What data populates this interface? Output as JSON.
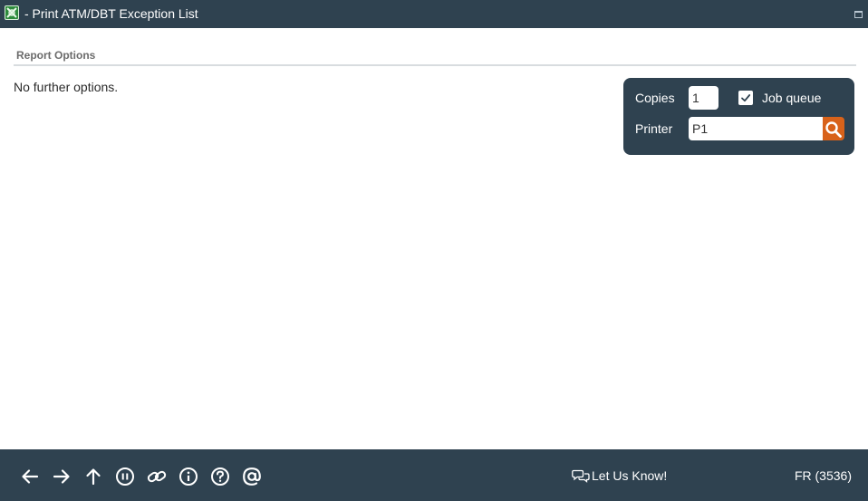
{
  "window": {
    "title": "- Print ATM/DBT Exception List",
    "app_icon": "app-logo-icon",
    "header_color": "#2f4250"
  },
  "report_options": {
    "header": "Report Options",
    "message": "No further options."
  },
  "print_settings": {
    "copies_label": "Copies",
    "copies_value": "1",
    "job_queue_label": "Job queue",
    "job_queue_checked": true,
    "printer_label": "Printer",
    "printer_value": "P1",
    "search_icon": "search-icon",
    "search_color": "#d8621a"
  },
  "footer": {
    "nav_icons": [
      "back-arrow-icon",
      "forward-arrow-icon",
      "up-arrow-icon",
      "pause-icon",
      "link-icon",
      "info-icon",
      "help-icon",
      "at-icon"
    ],
    "feedback_label": "Let Us Know!",
    "feedback_icon": "chat-icon",
    "function_code": "FR (3536)"
  }
}
